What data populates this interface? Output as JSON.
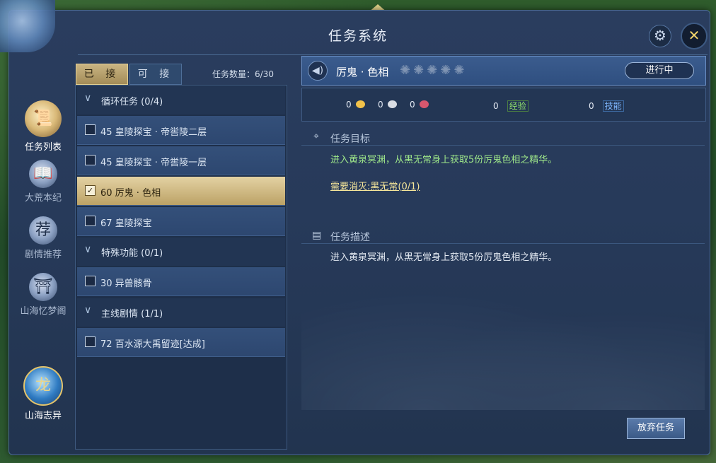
{
  "window": {
    "title": "任务系统"
  },
  "header_icons": {
    "settings_icon": "⚙",
    "close_icon": "✕"
  },
  "sidebar": {
    "items": [
      {
        "label": "任务列表",
        "icon": "scroll-icon",
        "glyph": "📜"
      },
      {
        "label": "大荒本纪",
        "icon": "book-icon",
        "glyph": "📖"
      },
      {
        "label": "剧情推荐",
        "icon": "recommend-icon",
        "glyph": "荐"
      },
      {
        "label": "山海忆梦阁",
        "icon": "pavilion-icon",
        "glyph": "⛩"
      },
      {
        "label": "山海志异",
        "icon": "dragon-emblem-icon",
        "glyph": "龙"
      }
    ]
  },
  "tabs": [
    {
      "label": "已 接"
    },
    {
      "label": "可 接"
    }
  ],
  "task_count": "任务数量：6/30",
  "list": {
    "rows": [
      {
        "type": "category",
        "label": "循环任务 (0/4)"
      },
      {
        "type": "task",
        "label": "45 皇陵探宝 · 帝喾陵二层",
        "checked": false
      },
      {
        "type": "task",
        "label": "45 皇陵探宝 · 帝喾陵一层",
        "checked": false
      },
      {
        "type": "task",
        "label": "60 厉鬼 · 色相",
        "checked": true
      },
      {
        "type": "task",
        "label": "67 皇陵探宝",
        "checked": false
      },
      {
        "type": "category",
        "label": "特殊功能 (0/1)"
      },
      {
        "type": "task",
        "label": "30 异兽骸骨",
        "checked": false
      },
      {
        "type": "category",
        "label": "主线剧情 (1/1)"
      },
      {
        "type": "task",
        "label": "72 百水源大禹留迹[达成]",
        "checked": false
      }
    ]
  },
  "quest": {
    "name": "厉鬼 · 色相",
    "status": "进行中",
    "stars_glyph": "✺✺✺✺✺",
    "star_count": 5,
    "rewards": {
      "gold": "0",
      "silver": "0",
      "red": "0",
      "exp_value": "0",
      "exp_label": "经验",
      "skill_value": "0",
      "skill_label": "技能"
    },
    "goal_title": "任务目标",
    "goal_text": "进入黄泉冥渊，从黑无常身上获取5份厉鬼色相之精华。",
    "kill_requirement": "需要消灭:黑无常(0/1)",
    "desc_title": "任务描述",
    "desc_text": "进入黄泉冥渊，从黑无常身上获取5份厉鬼色相之精华。"
  },
  "abandon_button": "放弃任务",
  "colors": {
    "accent_gold": "#e3d2a3",
    "panel_blue": "#273a5a",
    "goal_green": "#9fe88a"
  }
}
